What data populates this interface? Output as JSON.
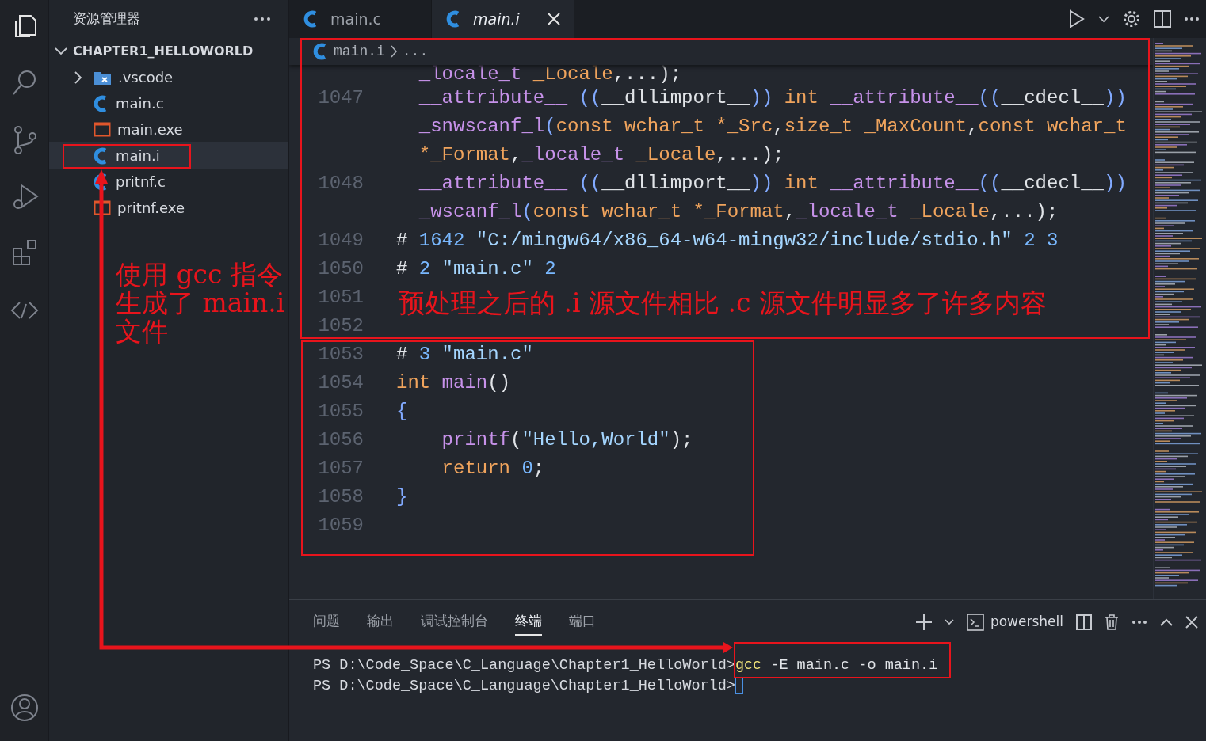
{
  "activity_bar": {
    "items": [
      {
        "kind": "explorer",
        "selected": true
      },
      {
        "kind": "search",
        "selected": false
      },
      {
        "kind": "source_control",
        "selected": false
      },
      {
        "kind": "run_debug",
        "selected": false
      },
      {
        "kind": "extensions",
        "selected": false
      },
      {
        "kind": "remote",
        "selected": false
      }
    ],
    "account": {
      "kind": "account"
    }
  },
  "sidebar": {
    "title": "资源管理器",
    "folder": {
      "name": "CHAPTER1_HELLOWORLD",
      "expanded": true
    },
    "files": [
      {
        "name": ".vscode",
        "kind": "folder",
        "expanded": false,
        "selected": false
      },
      {
        "name": "main.c",
        "kind": "c",
        "selected": false
      },
      {
        "name": "main.exe",
        "kind": "exe",
        "selected": false
      },
      {
        "name": "main.i",
        "kind": "c",
        "selected": true
      },
      {
        "name": "pritnf.c",
        "kind": "c",
        "selected": false
      },
      {
        "name": "pritnf.exe",
        "kind": "exe",
        "selected": false
      }
    ]
  },
  "tabs": [
    {
      "label": "main.c",
      "selected": false,
      "preview": false
    },
    {
      "label": "main.i",
      "selected": true,
      "preview": true
    }
  ],
  "breadcrumb": {
    "file": "main.i",
    "more": "..."
  },
  "code_rows": [
    {
      "tokens": [
        {
          "kind": "fn",
          "t": "  _locale_t"
        },
        {
          "kind": "kw",
          "t": " _Locale"
        },
        {
          "kind": "pl",
          "t": ",...);"
        }
      ]
    },
    {
      "number": "1047",
      "tokens": [
        {
          "kind": "fn",
          "t": "  __attribute__"
        },
        {
          "kind": "bl",
          "t": " (("
        },
        {
          "kind": "pl",
          "t": "__dllimport__"
        },
        {
          "kind": "bl",
          "t": "))"
        },
        {
          "kind": "kw",
          "t": " int"
        },
        {
          "kind": "fn",
          "t": " __attribute__"
        },
        {
          "kind": "bl",
          "t": "(("
        },
        {
          "kind": "pl",
          "t": "__cdecl__"
        },
        {
          "kind": "bl",
          "t": "))"
        }
      ]
    },
    {
      "tokens": [
        {
          "kind": "fn",
          "t": "  _snwscanf_l"
        },
        {
          "kind": "bl",
          "t": "("
        },
        {
          "kind": "kw",
          "t": "const wchar_t *_Src"
        },
        {
          "kind": "pl",
          "t": ","
        },
        {
          "kind": "kw",
          "t": "size_t _MaxCount"
        },
        {
          "kind": "pl",
          "t": ","
        },
        {
          "kind": "kw",
          "t": "const wchar_t"
        }
      ]
    },
    {
      "tokens": [
        {
          "kind": "kw",
          "t": "  *_Format"
        },
        {
          "kind": "pl",
          "t": ","
        },
        {
          "kind": "fn",
          "t": "_locale_t"
        },
        {
          "kind": "kw",
          "t": " _Locale"
        },
        {
          "kind": "pl",
          "t": ",...);"
        }
      ]
    },
    {
      "number": "1048",
      "tokens": [
        {
          "kind": "fn",
          "t": "  __attribute__"
        },
        {
          "kind": "bl",
          "t": " (("
        },
        {
          "kind": "pl",
          "t": "__dllimport__"
        },
        {
          "kind": "bl",
          "t": "))"
        },
        {
          "kind": "kw",
          "t": " int"
        },
        {
          "kind": "fn",
          "t": " __attribute__"
        },
        {
          "kind": "bl",
          "t": "(("
        },
        {
          "kind": "pl",
          "t": "__cdecl__"
        },
        {
          "kind": "bl",
          "t": "))"
        }
      ]
    },
    {
      "tokens": [
        {
          "kind": "fn",
          "t": "  _wscanf_l"
        },
        {
          "kind": "bl",
          "t": "("
        },
        {
          "kind": "kw",
          "t": "const wchar_t *_Format"
        },
        {
          "kind": "pl",
          "t": ","
        },
        {
          "kind": "fn",
          "t": "_locale_t"
        },
        {
          "kind": "kw",
          "t": " _Locale"
        },
        {
          "kind": "pl",
          "t": ",...);"
        }
      ]
    },
    {
      "number": "1049",
      "tokens": [
        {
          "kind": "pl",
          "t": "#"
        },
        {
          "kind": "num",
          "t": " 1642"
        },
        {
          "kind": "str",
          "t": " \"C:/mingw64/x86_64-w64-mingw32/include/stdio.h\""
        },
        {
          "kind": "num",
          "t": " 2 3"
        }
      ]
    },
    {
      "number": "1050",
      "tokens": [
        {
          "kind": "pl",
          "t": "#"
        },
        {
          "kind": "num",
          "t": " 2"
        },
        {
          "kind": "str",
          "t": " \"main.c\""
        },
        {
          "kind": "num",
          "t": " 2"
        }
      ]
    },
    {
      "number": "1051",
      "tokens": []
    },
    {
      "number": "1052",
      "tokens": []
    },
    {
      "number": "1053",
      "tokens": [
        {
          "kind": "pl",
          "t": "#"
        },
        {
          "kind": "num",
          "t": " 3"
        },
        {
          "kind": "str",
          "t": " \"main.c\""
        }
      ]
    },
    {
      "number": "1054",
      "tokens": [
        {
          "kind": "kw",
          "t": "int"
        },
        {
          "kind": "fn",
          "t": " main"
        },
        {
          "kind": "pl",
          "t": "()"
        }
      ]
    },
    {
      "number": "1055",
      "tokens": [
        {
          "kind": "bl",
          "t": "{"
        }
      ]
    },
    {
      "number": "1056",
      "tokens": [
        {
          "kind": "fn",
          "t": "    printf"
        },
        {
          "kind": "pl",
          "t": "("
        },
        {
          "kind": "str",
          "t": "\"Hello,World\""
        },
        {
          "kind": "pl",
          "t": ");"
        }
      ]
    },
    {
      "number": "1057",
      "tokens": [
        {
          "kind": "kw",
          "t": "    return"
        },
        {
          "kind": "num",
          "t": " 0"
        },
        {
          "kind": "pl",
          "t": ";"
        }
      ]
    },
    {
      "number": "1058",
      "tokens": [
        {
          "kind": "bl",
          "t": "}"
        }
      ]
    },
    {
      "number": "1059",
      "tokens": []
    }
  ],
  "panel": {
    "tabs": [
      {
        "label": "问题",
        "selected": false
      },
      {
        "label": "输出",
        "selected": false
      },
      {
        "label": "调试控制台",
        "selected": false
      },
      {
        "label": "终端",
        "selected": true
      },
      {
        "label": "端口",
        "selected": false
      }
    ],
    "shell": "powershell",
    "terminal_lines": [
      {
        "prompt": "PS D:\\Code_Space\\C_Language\\Chapter1_HelloWorld>",
        "command": [
          {
            "kind": "cmd",
            "t": "gcc"
          },
          {
            "kind": "arg",
            "t": " -E main.c -o main.i"
          }
        ],
        "cursor": false
      },
      {
        "prompt": "PS D:\\Code_Space\\C_Language\\Chapter1_HelloWorld>",
        "cursor": true
      }
    ]
  },
  "annotations": [
    {
      "lines": [
        "使用 gcc 指令",
        "生成了 main.i",
        "文件"
      ]
    },
    {
      "lines": [
        "预处理之后的 .i 源文件相比 .c 源文件明显多了许多内容"
      ]
    }
  ]
}
